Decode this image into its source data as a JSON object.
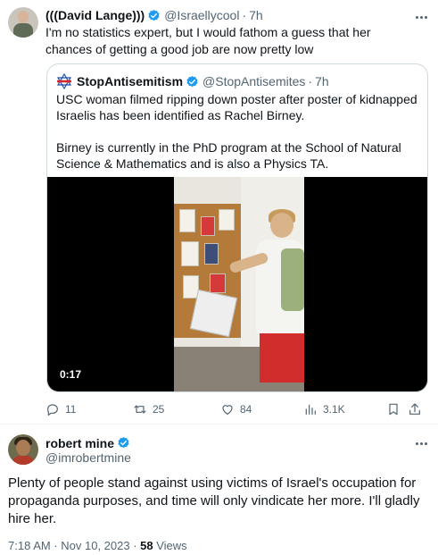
{
  "colors": {
    "verified": "#1d9bf0",
    "text": "#0f1419",
    "muted": "#536471",
    "border": "#cfd9de"
  },
  "tweet": {
    "name": "(((David Lange)))",
    "handle": "@Israellycool",
    "sep": "·",
    "time": "7h",
    "text": "I'm no statistics expert, but I would fathom a guess that her chances of getting a good job are now pretty low",
    "quote": {
      "name": "StopAntisemitism",
      "handle": "@StopAntisemites",
      "sep": "·",
      "time": "7h",
      "para1": "USC woman filmed ripping down poster after poster of kidnapped Israelis has been identified as Rachel Birney.",
      "para2": "Birney is currently in the PhD program at the School of Natural Science & Mathematics and is also a Physics TA.",
      "video_duration": "0:17"
    },
    "actions": {
      "replies": "11",
      "retweets": "25",
      "likes": "84",
      "views": "3.1K"
    }
  },
  "reply": {
    "name": "robert mine",
    "handle": "@imrobertmine",
    "text": "Plenty of people stand against using victims of Israel's occupation for propaganda purposes, and time will only vindicate her more. I'll gladly hire her.",
    "timestamp": "7:18 AM · Nov 10, 2023 · ",
    "views_count": "58",
    "views_label": " Views"
  }
}
